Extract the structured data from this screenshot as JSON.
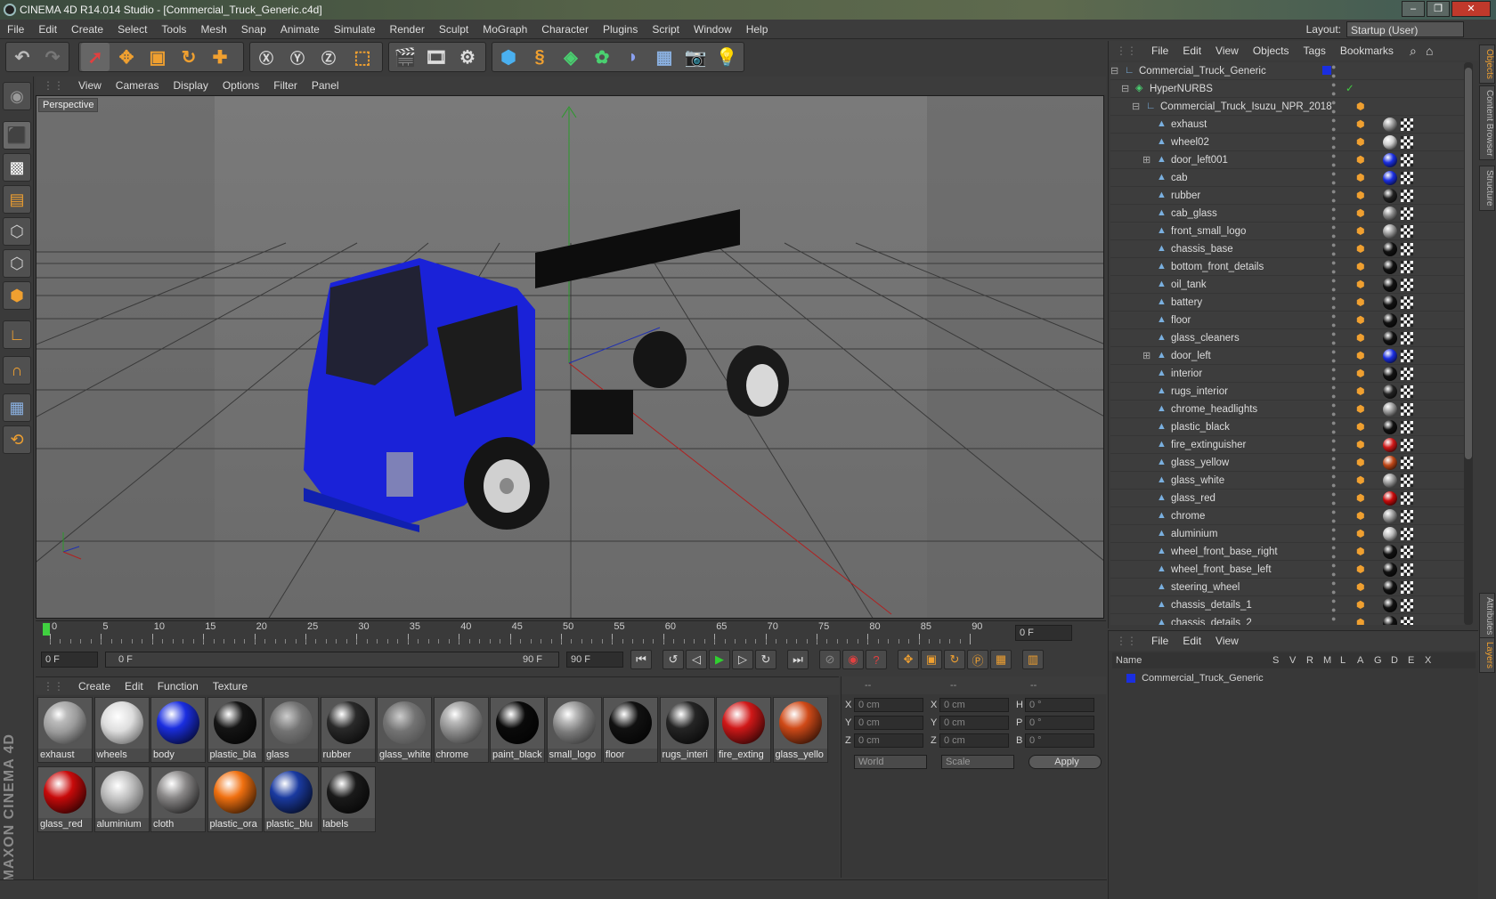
{
  "window": {
    "title": "CINEMA 4D R14.014 Studio - [Commercial_Truck_Generic.c4d]",
    "min": "–",
    "max": "❐",
    "close": "✕"
  },
  "menu": [
    "File",
    "Edit",
    "Create",
    "Select",
    "Tools",
    "Mesh",
    "Snap",
    "Animate",
    "Simulate",
    "Render",
    "Sculpt",
    "MoGraph",
    "Character",
    "Plugins",
    "Script",
    "Window",
    "Help"
  ],
  "layout": {
    "label": "Layout:",
    "value": "Startup (User)"
  },
  "viewport": {
    "menu": [
      "View",
      "Cameras",
      "Display",
      "Options",
      "Filter",
      "Panel"
    ],
    "label": "Perspective"
  },
  "timeline": {
    "ticks": [
      "0",
      "5",
      "10",
      "15",
      "20",
      "25",
      "30",
      "35",
      "40",
      "45",
      "50",
      "55",
      "60",
      "65",
      "70",
      "75",
      "80",
      "85",
      "90"
    ],
    "current": "0 F"
  },
  "transport": {
    "start": "0 F",
    "range_start": "0 F",
    "range_end": "90 F",
    "end": "90 F"
  },
  "materials": {
    "menu": [
      "Create",
      "Edit",
      "Function",
      "Texture"
    ],
    "items": [
      {
        "name": "exhaust",
        "color": "#9a9a9a",
        "style": "chrome"
      },
      {
        "name": "wheels",
        "color": "#dddddd",
        "style": "white"
      },
      {
        "name": "body",
        "color": "#1a2ee0",
        "style": "solid"
      },
      {
        "name": "plastic_bla",
        "color": "#151515",
        "style": "solid"
      },
      {
        "name": "glass",
        "color": "#8a8a8a",
        "style": "glass"
      },
      {
        "name": "rubber",
        "color": "#2a2a2a",
        "style": "solid"
      },
      {
        "name": "glass_white",
        "color": "#a0a0a0",
        "style": "glass"
      },
      {
        "name": "chrome",
        "color": "#888888",
        "style": "chrome"
      },
      {
        "name": "paint_black",
        "color": "#0a0a0a",
        "style": "solid"
      },
      {
        "name": "small_logo",
        "color": "#7a7a7a",
        "style": "chrome"
      },
      {
        "name": "floor",
        "color": "#111111",
        "style": "solid"
      },
      {
        "name": "rugs_interi",
        "color": "#252525",
        "style": "solid"
      },
      {
        "name": "fire_exting",
        "color": "#d01818",
        "style": "solid"
      },
      {
        "name": "glass_yello",
        "color": "#d04a18",
        "style": "solid"
      },
      {
        "name": "glass_red",
        "color": "#c80a0a",
        "style": "solid"
      },
      {
        "name": "aluminium",
        "color": "#bbbbbb",
        "style": "white"
      },
      {
        "name": "cloth",
        "color": "#8a8888",
        "style": "solid"
      },
      {
        "name": "plastic_ora",
        "color": "#f07010",
        "style": "solid"
      },
      {
        "name": "plastic_blu",
        "color": "#1a3aa0",
        "style": "solid"
      },
      {
        "name": "labels",
        "color": "#1a1a1a",
        "style": "solid"
      }
    ]
  },
  "coords": {
    "header": [
      "--",
      "--",
      "--"
    ],
    "rows": [
      {
        "a": "X",
        "av": "0 cm",
        "b": "X",
        "bv": "0 cm",
        "c": "H",
        "cv": "0 °"
      },
      {
        "a": "Y",
        "av": "0 cm",
        "b": "Y",
        "bv": "0 cm",
        "c": "P",
        "cv": "0 °"
      },
      {
        "a": "Z",
        "av": "0 cm",
        "b": "Z",
        "bv": "0 cm",
        "c": "B",
        "cv": "0 °"
      }
    ],
    "world": "World",
    "scale": "Scale",
    "apply": "Apply"
  },
  "objects": {
    "menu": [
      "File",
      "Edit",
      "View",
      "Objects",
      "Tags",
      "Bookmarks"
    ],
    "root": "Commercial_Truck_Generic",
    "nurbs": "HyperNURBS",
    "group": "Commercial_Truck_Isuzu_NPR_2018",
    "items": [
      {
        "name": "exhaust",
        "mat": "#999999"
      },
      {
        "name": "wheel02",
        "mat": "#cccccc"
      },
      {
        "name": "door_left001",
        "mat": "#1a2ee0",
        "exp": true
      },
      {
        "name": "cab",
        "mat": "#1a2ee0"
      },
      {
        "name": "rubber",
        "mat": "#222222"
      },
      {
        "name": "cab_glass",
        "mat": "#888888"
      },
      {
        "name": "front_small_logo",
        "mat": "#999999"
      },
      {
        "name": "chassis_base",
        "mat": "#111111"
      },
      {
        "name": "bottom_front_details",
        "mat": "#111111"
      },
      {
        "name": "oil_tank",
        "mat": "#111111"
      },
      {
        "name": "battery",
        "mat": "#111111"
      },
      {
        "name": "floor",
        "mat": "#111111"
      },
      {
        "name": "glass_cleaners",
        "mat": "#111111"
      },
      {
        "name": "door_left",
        "mat": "#1a2ee0",
        "exp": true
      },
      {
        "name": "interior",
        "mat": "#111111"
      },
      {
        "name": "rugs_interior",
        "mat": "#222222"
      },
      {
        "name": "chrome_headlights",
        "mat": "#999999"
      },
      {
        "name": "plastic_black",
        "mat": "#111111"
      },
      {
        "name": "fire_extinguisher",
        "mat": "#d01818"
      },
      {
        "name": "glass_yellow",
        "mat": "#c04818"
      },
      {
        "name": "glass_white",
        "mat": "#999999"
      },
      {
        "name": "glass_red",
        "mat": "#c80a0a"
      },
      {
        "name": "chrome",
        "mat": "#999999"
      },
      {
        "name": "aluminium",
        "mat": "#bbbbbb"
      },
      {
        "name": "wheel_front_base_right",
        "mat": "#111111"
      },
      {
        "name": "wheel_front_base_left",
        "mat": "#111111"
      },
      {
        "name": "steering_wheel",
        "mat": "#111111"
      },
      {
        "name": "chassis_details_1",
        "mat": "#111111"
      },
      {
        "name": "chassis_details_2",
        "mat": "#111111"
      }
    ]
  },
  "layers": {
    "menu": [
      "File",
      "Edit",
      "View"
    ],
    "cols": [
      "Name",
      "S",
      "V",
      "R",
      "M",
      "L",
      "A",
      "G",
      "D",
      "E",
      "X"
    ],
    "row": "Commercial_Truck_Generic"
  },
  "sidetabs": [
    "Objects",
    "Content Browser",
    "Structure",
    "Attributes",
    "Layers"
  ],
  "brand": "MAXON CINEMA 4D",
  "colors": {
    "accent": "#f0a030",
    "blue_paint": "#1a2ee0"
  }
}
